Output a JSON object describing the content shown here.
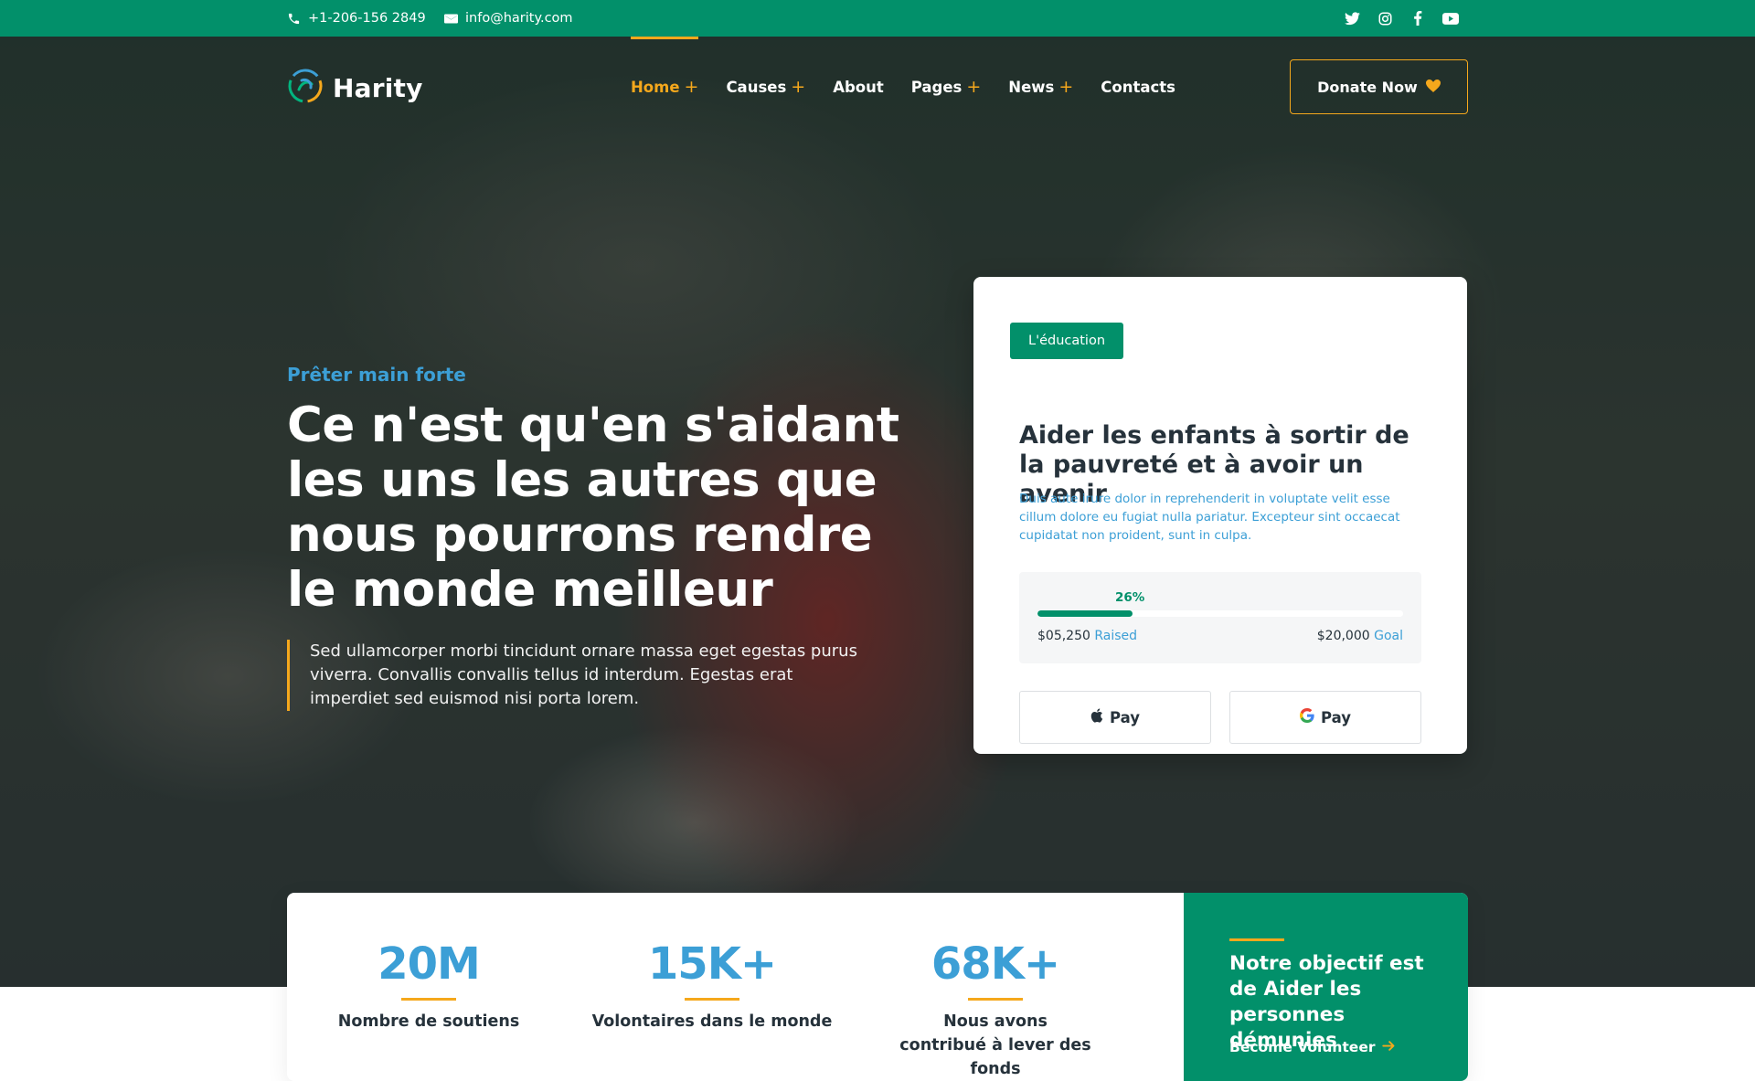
{
  "topbar": {
    "phone": "+1-206-156 2849",
    "email": "info@harity.com",
    "social": [
      "twitter-icon",
      "instagram-icon",
      "facebook-icon",
      "youtube-icon"
    ]
  },
  "brand": {
    "name": "Harity"
  },
  "nav": {
    "items": [
      {
        "label": "Home",
        "has_submenu": true,
        "active": true
      },
      {
        "label": "Causes",
        "has_submenu": true,
        "active": false
      },
      {
        "label": "About",
        "has_submenu": false,
        "active": false
      },
      {
        "label": "Pages",
        "has_submenu": true,
        "active": false
      },
      {
        "label": "News",
        "has_submenu": true,
        "active": false
      },
      {
        "label": "Contacts",
        "has_submenu": false,
        "active": false
      }
    ],
    "plus": "+",
    "donate_label": "Donate Now"
  },
  "hero": {
    "eyebrow": "Prêter main forte",
    "headline": "Ce n'est qu'en s'aidant les uns les autres que nous pourrons rendre le monde meilleur",
    "lead": "Sed ullamcorper morbi tincidunt ornare massa eget egestas purus viverra. Convallis convallis tellus id interdum. Egestas erat imperdiet sed euismod nisi porta lorem."
  },
  "cause_card": {
    "tag": "L'éducation",
    "title": "Aider les enfants à sortir de la pauvreté et à avoir un avenir",
    "description": "Duis aute irure dolor in reprehenderit in voluptate velit esse cillum dolore eu fugiat nulla pariatur. Excepteur sint occaecat cupidatat non proident, sunt in culpa.",
    "progress_percent": 26,
    "progress_label": "26%",
    "raised_amount": "$05,250",
    "raised_label": "Raised",
    "goal_amount": "$20,000",
    "goal_label": "Goal",
    "pay_apple_label": "Pay",
    "pay_google_label": "Pay"
  },
  "stats": [
    {
      "value": "20M",
      "label": "Nombre de soutiens"
    },
    {
      "value": "15K+",
      "label": "Volontaires dans le monde"
    },
    {
      "value": "68K+",
      "label": "Nous avons contribué à lever des fonds"
    }
  ],
  "objective": {
    "text": "Notre objectif est de Aider les personnes démunies",
    "link_label": "Become Volunteer"
  },
  "colors": {
    "primary_green": "#02906a",
    "accent_orange": "#f5a81c",
    "accent_blue": "#3c9fd6",
    "text_dark": "#26323b"
  }
}
